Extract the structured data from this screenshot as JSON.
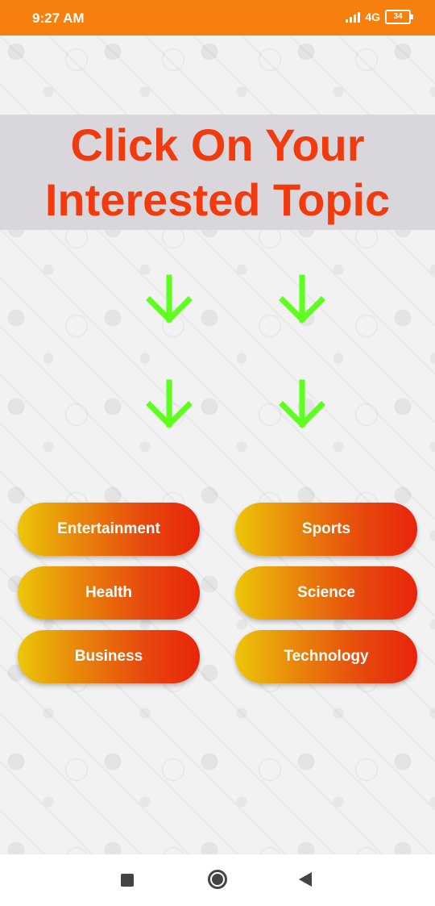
{
  "status_bar": {
    "time": "9:27 AM",
    "network": "4G",
    "battery": "34"
  },
  "banner": {
    "headline": "Click On Your Interested Topic"
  },
  "colors": {
    "status_bar": "#f77f0e",
    "headline": "#f13a0d",
    "arrow": "#5dff1c",
    "button_gradient_start": "#ecc60a",
    "button_gradient_end": "#e9240c"
  },
  "topics": [
    {
      "label": "Entertainment"
    },
    {
      "label": "Sports"
    },
    {
      "label": "Health"
    },
    {
      "label": "Science"
    },
    {
      "label": "Business"
    },
    {
      "label": "Technology"
    }
  ],
  "nav_bar": {
    "icons": [
      "recents-square-icon",
      "home-circle-icon",
      "back-triangle-icon"
    ]
  }
}
